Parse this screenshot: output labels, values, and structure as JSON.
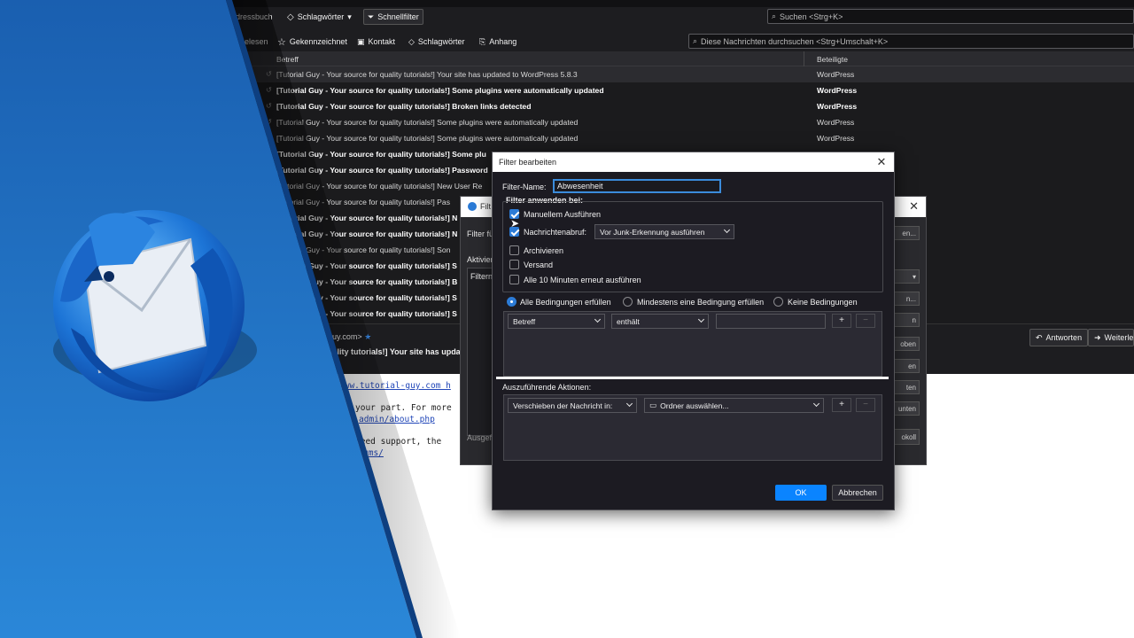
{
  "colors": {
    "accent_blue": "#2c7bd6",
    "ok_blue": "#0a84ff",
    "overlay_blue": "#1e72c6",
    "dark_bg": "#1c1b22"
  },
  "toolbar": {
    "address_book": "dressbuch",
    "tags": "Schlagwörter",
    "quick_filter": "Schnellfilter",
    "search_placeholder": "Suchen <Strg+K>"
  },
  "quick_filter_bar": {
    "unread": "elesen",
    "starred": "Gekennzeichnet",
    "contact": "Kontakt",
    "tags": "Schlagwörter",
    "attachment": "Anhang",
    "search_placeholder": "Diese Nachrichten durchsuchen <Strg+Umschalt+K>"
  },
  "thread_list": {
    "col_subject": "Betreff",
    "col_participants": "Beteiligte",
    "rows": [
      {
        "subject": "[Tutorial Guy - Your source for quality tutorials!] Your site has updated to WordPress 5.8.3",
        "from": "WordPress"
      },
      {
        "subject": "[Tutorial Guy - Your source for quality tutorials!] Some plugins were automatically updated",
        "from": "WordPress"
      },
      {
        "subject": "[Tutorial Guy - Your source for quality tutorials!] Broken links detected",
        "from": "WordPress"
      },
      {
        "subject": "[Tutorial Guy - Your source for quality tutorials!] Some plugins were automatically updated",
        "from": "WordPress"
      },
      {
        "subject": "[Tutorial Guy - Your source for quality tutorials!] Some plugins were automatically updated",
        "from": "WordPress"
      },
      {
        "subject": "[Tutorial Guy - Your source for quality tutorials!] Some plu",
        "from": ""
      },
      {
        "subject": "[Tutorial Guy - Your source for quality tutorials!] Password",
        "from": ""
      },
      {
        "subject": "[Tutorial Guy - Your source for quality tutorials!] New User Re",
        "from": ""
      },
      {
        "subject": "[Tutorial Guy - Your source for quality tutorials!] Pas",
        "from": ""
      },
      {
        "subject": "[Tutorial Guy - Your source for quality tutorials!] N",
        "from": ""
      },
      {
        "subject": "[Tutorial Guy - Your source for quality tutorials!] N",
        "from": ""
      },
      {
        "subject": "[Tutorial Guy - Your source for quality tutorials!] Son",
        "from": ""
      },
      {
        "subject": "[Tutorial Guy - Your source for quality tutorials!] S",
        "from": ""
      },
      {
        "subject": "[Tutorial Guy - Your source for quality tutorials!] B",
        "from": ""
      },
      {
        "subject": "[Tutorial Guy - Your source for quality tutorials!] S",
        "from": ""
      },
      {
        "subject": "[Tutorial Guy - Your source for quality tutorials!] S",
        "from": ""
      }
    ]
  },
  "preview": {
    "from": "guy.com>",
    "subject": "uality tutorials!] Your site has upda",
    "reply": "Antworten",
    "forward": "Weiterlei",
    "body_lines": [
      "www.tutorial-guy.com h",
      "your part. For more",
      "admin/about.php",
      "need support, the",
      "ums/"
    ]
  },
  "filter_list_dialog": {
    "title": "Filt",
    "filter_for": "Filter fü",
    "active": "Aktivier",
    "filter_name_col": "Filtern",
    "executed": "Ausgef",
    "side_buttons": [
      "en...",
      "n...",
      "n",
      "oben",
      "en",
      "ten",
      "unten",
      "okoll"
    ]
  },
  "filter_dialog": {
    "title": "Filter bearbeiten",
    "name_label": "Filter-Name:",
    "name_value": "Abwesenheit",
    "apply_label": "Filter anwenden bei:",
    "manual": "Manuellem Ausführen",
    "fetch": "Nachrichtenabruf:",
    "fetch_option": "Vor Junk-Erkennung ausführen",
    "archive": "Archivieren",
    "send": "Versand",
    "periodic": "Alle 10 Minuten erneut ausführen",
    "match_all": "Alle Bedingungen erfüllen",
    "match_any": "Mindestens eine Bedingung erfüllen",
    "match_none": "Keine Bedingungen",
    "condition_field": "Betreff",
    "condition_op": "enthält",
    "condition_value": "",
    "actions_label": "Auszuführende Aktionen:",
    "action_type": "Verschieben der Nachricht in:",
    "action_target": "Ordner auswählen...",
    "ok": "OK",
    "cancel": "Abbrechen",
    "plus": "+",
    "minus": "−"
  }
}
